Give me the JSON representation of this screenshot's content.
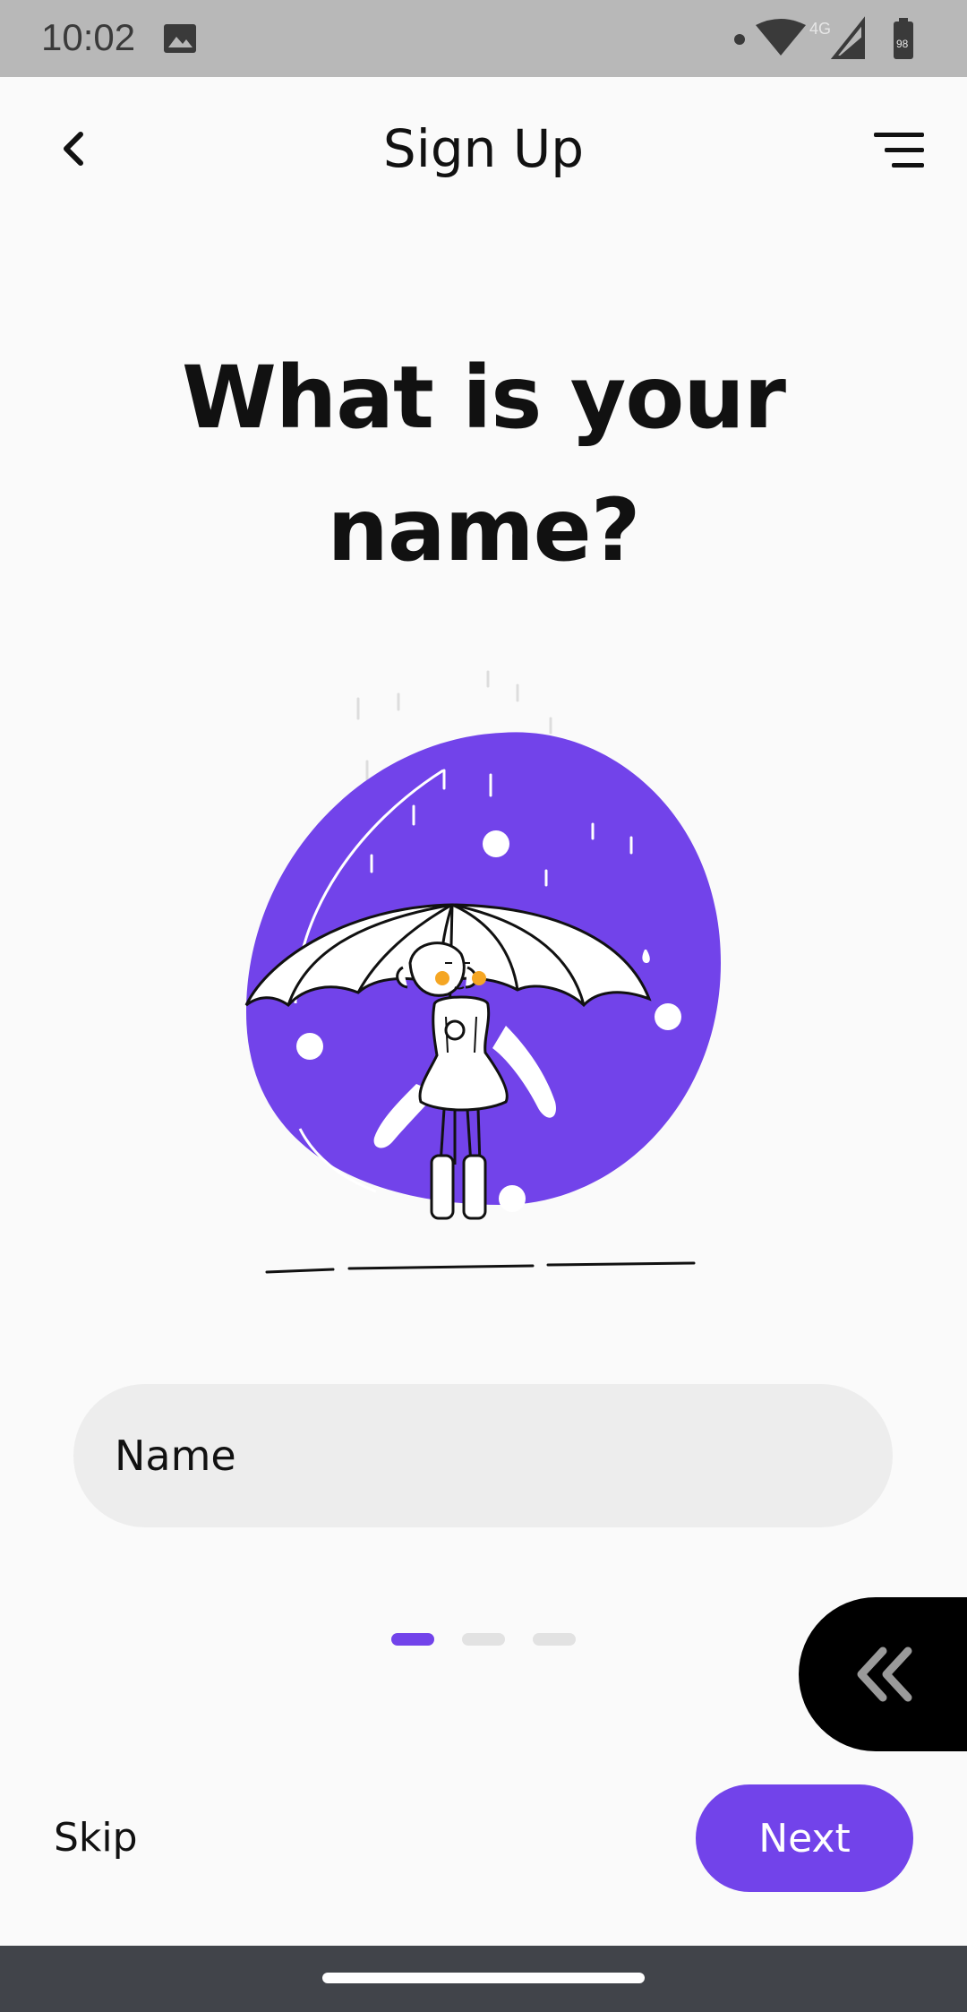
{
  "status_bar": {
    "time": "10:02",
    "network": "4G",
    "battery": "98",
    "icons": [
      "image-icon",
      "dot-icon",
      "wifi-icon",
      "signal-icon",
      "battery-icon"
    ]
  },
  "app_bar": {
    "title": "Sign Up",
    "back_icon": "chevron-left-icon",
    "menu_icon": "menu-lines-icon"
  },
  "content": {
    "question": "What is your name?",
    "illustration": "girl-with-umbrella-in-rain",
    "name_placeholder": "Name",
    "name_value": ""
  },
  "pager": {
    "pages": 3,
    "current": 1
  },
  "footer": {
    "skip_label": "Skip",
    "next_label": "Next",
    "float_icon": "double-chevron-left-icon"
  },
  "colors": {
    "accent": "#7243ea",
    "background": "#fafafa",
    "input_bg": "#ededed",
    "float_button": "#000000"
  }
}
